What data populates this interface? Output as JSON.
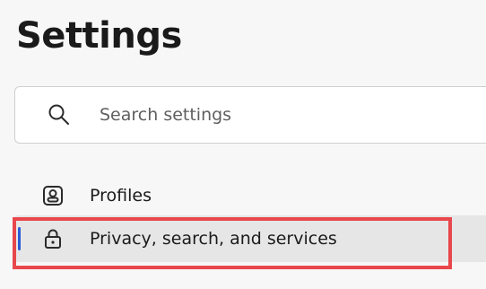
{
  "page": {
    "title": "Settings"
  },
  "search": {
    "placeholder": "Search settings",
    "icon": "search-icon"
  },
  "nav": {
    "items": [
      {
        "label": "Profiles",
        "icon": "profile-icon",
        "selected": false
      },
      {
        "label": "Privacy, search, and services",
        "icon": "lock-icon",
        "selected": true
      }
    ]
  },
  "colors": {
    "selection_indicator": "#2a5bd7",
    "highlight_annotation": "#e8474c",
    "selected_background": "#e6e6e6",
    "page_background": "#f7f7f7"
  }
}
